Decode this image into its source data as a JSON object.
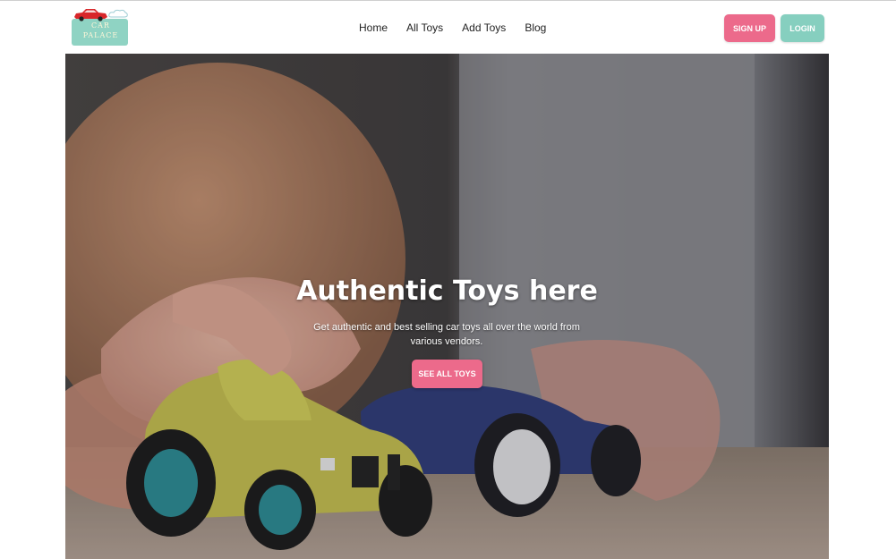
{
  "brand": {
    "logo_line1": "CAR",
    "logo_line2": "PALACE",
    "icon": "red-toy-car-logo"
  },
  "nav": {
    "links": [
      "Home",
      "All Toys",
      "Add Toys",
      "Blog"
    ]
  },
  "auth": {
    "signup_label": "SIGN UP",
    "login_label": "LOGIN"
  },
  "hero": {
    "title": "Authentic Toys here",
    "subtitle": "Get authentic and best selling car toys all over the world from various vendors.",
    "cta_label": "SEE ALL TOYS"
  },
  "colors": {
    "primary_pink": "#ec6a8b",
    "secondary_teal": "#86cfbf"
  }
}
